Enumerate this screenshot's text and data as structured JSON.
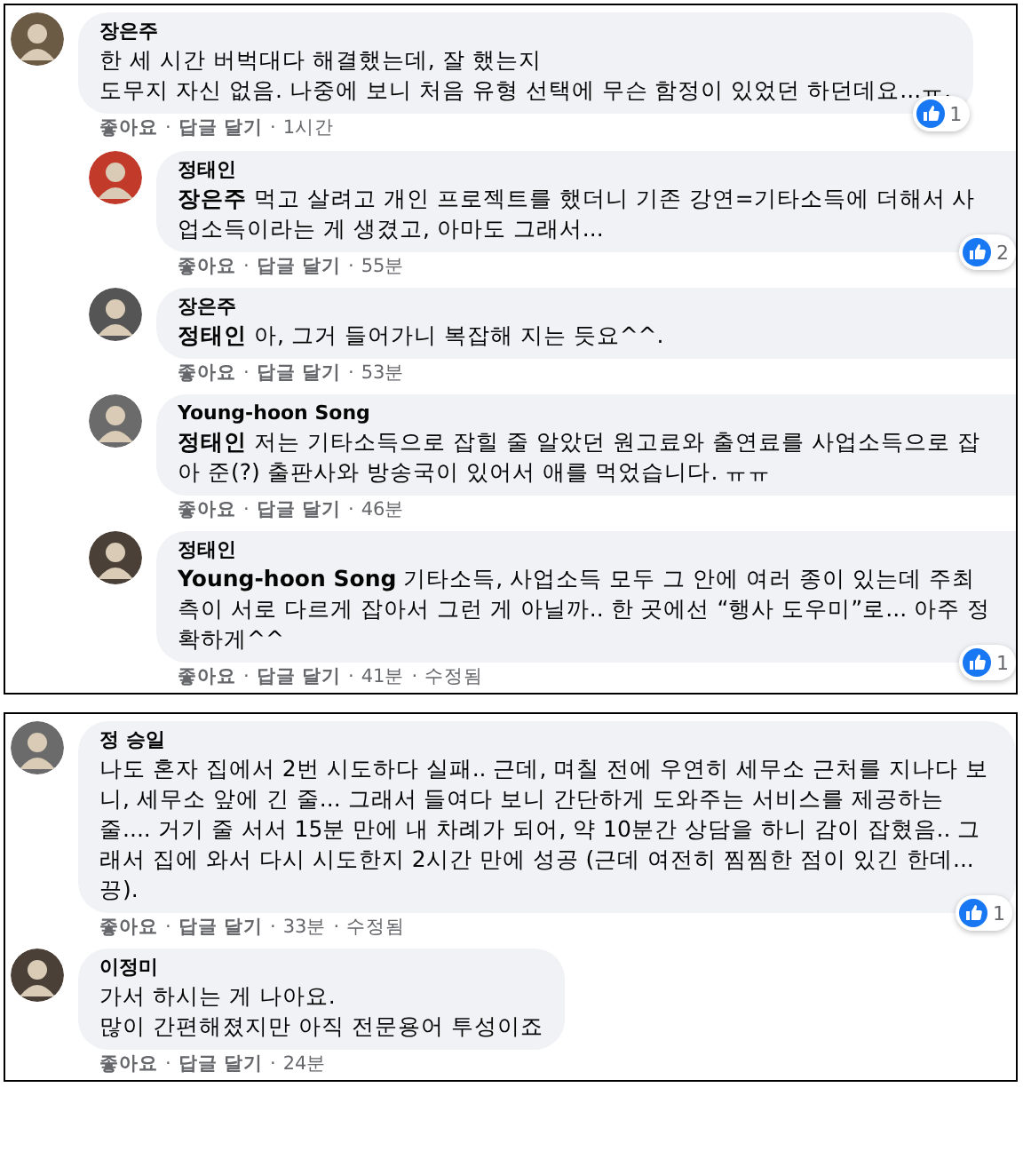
{
  "separator": "·",
  "panels": [
    {
      "comments": [
        {
          "author": "장은주",
          "text": "한 세 시간 버벅대다 해결했는데, 잘 했는지\n도무지 자신 없음. 나중에 보니 처음 유형 선택에 무슨 함정이 있었던 하던데요...ㅠ.",
          "actions": [
            "좋아요",
            "답글 달기"
          ],
          "time": "1시간",
          "reactions": "1",
          "replies": [
            {
              "author": "정태인",
              "text": "**장은주** 먹고 살려고 개인 프로젝트를 했더니 기존 강연=기타소득에 더해서 사업소득이라는 게 생겼고, 아마도 그래서...",
              "actions": [
                "좋아요",
                "답글 달기"
              ],
              "time": "55분",
              "reactions": "2"
            },
            {
              "author": "장은주",
              "text": "**정태인** 아, 그거 들어가니 복잡해 지는 듯요^^.",
              "actions": [
                "좋아요",
                "답글 달기"
              ],
              "time": "53분"
            },
            {
              "author": "Young-hoon Song",
              "text": "**정태인** 저는 기타소득으로 잡힐 줄 알았던 원고료와 출연료를 사업소득으로 잡아 준(?) 출판사와 방송국이 있어서 애를 먹었습니다. ㅠㅠ",
              "actions": [
                "좋아요",
                "답글 달기"
              ],
              "time": "46분"
            },
            {
              "author": "정태인",
              "text": "**Young-hoon Song** 기타소득, 사업소득 모두 그 안에 여러 종이 있는데 주최 측이 서로 다르게 잡아서 그런 게 아닐까.. 한 곳에선 “행사 도우미”로... 아주 정확하게^^",
              "actions": [
                "좋아요",
                "답글 달기"
              ],
              "time": "41분",
              "edited": "수정됨",
              "reactions": "1"
            }
          ]
        }
      ]
    },
    {
      "comments": [
        {
          "author": "정 승일",
          "text": "나도 혼자 집에서 2번 시도하다 실패.. 근데, 며칠 전에 우연히 세무소 근처를 지나다 보니, 세무소 앞에 긴 줄... 그래서 들여다 보니 간단하게 도와주는 서비스를 제공하는 줄.... 거기 줄 서서 15분 만에 내 차례가 되어, 약 10분간 상담을 하니 감이 잡혔음.. 그래서 집에 와서 다시 시도한지 2시간 만에 성공 (근데 여전히 찜찜한 점이 있긴 한데... 끙).",
          "actions": [
            "좋아요",
            "답글 달기"
          ],
          "time": "33분",
          "edited": "수정됨",
          "reactions": "1"
        },
        {
          "author": "이정미",
          "text": "가서 하시는 게 나아요.\n많이 간편해졌지만 아직 전문용어 투성이죠",
          "actions": [
            "좋아요",
            "답글 달기"
          ],
          "time": "24분"
        }
      ]
    }
  ]
}
